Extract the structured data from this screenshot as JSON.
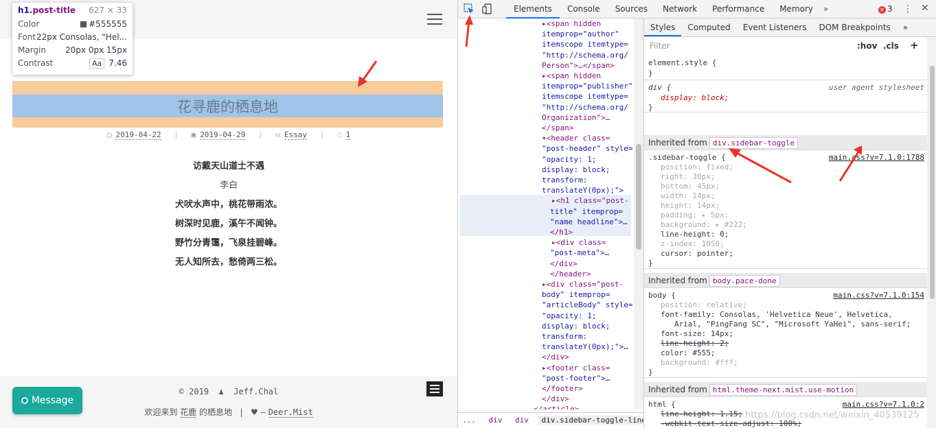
{
  "page": {
    "title": "花寻鹿的栖息地",
    "meta": [
      {
        "icon": "calendar-icon",
        "value": "2019-04-22"
      },
      {
        "icon": "calendar-check-icon",
        "value": "2019-04-29"
      },
      {
        "icon": "folder-icon",
        "value": "Essay"
      },
      {
        "icon": "comment-icon",
        "value": "1"
      }
    ],
    "poem": {
      "title": "访戴天山道士不遇",
      "author": "李白",
      "lines": [
        "犬吠水声中，桃花带雨浓。",
        "树深时见鹿，溪午不闻钟。",
        "野竹分青霭，飞泉挂碧峰。",
        "无人知所去，愁倚两三松。"
      ]
    },
    "footer": {
      "copyright": "© 2019",
      "author": "Jeff.Chal",
      "welcome_prefix": "欢迎来到",
      "welcome_link": "花鹿",
      "welcome_suffix": "的栖息地",
      "separator": "|",
      "deer_link": "Deer.Mist",
      "dash": "–"
    },
    "message_button": "Message",
    "colors": {
      "title_bg": "#9fc4e7",
      "margin_bg": "#f9cc9d",
      "message_bg": "#1aa99a"
    }
  },
  "tooltip": {
    "selector_tag": "h1",
    "selector_class": ".post-title",
    "dims": "627 × 33",
    "rows": [
      {
        "label": "Color",
        "value": "#555555"
      },
      {
        "label": "Font",
        "value": "22px Consolas, \"Hel..."
      },
      {
        "label": "Margin",
        "value": "20px 0px 15px"
      },
      {
        "label": "Contrast",
        "badge": "Aa",
        "value": "7.46"
      }
    ]
  },
  "devtools": {
    "tabs": [
      "Elements",
      "Console",
      "Sources",
      "Network",
      "Performance",
      "Memory"
    ],
    "active_tab": "Elements",
    "error_count": "3",
    "style_tabs": [
      "Styles",
      "Computed",
      "Event Listeners",
      "DOM Breakpoints"
    ],
    "active_style_tab": "Styles",
    "filter_placeholder": "Filter",
    "hov": ":hov",
    "cls": ".cls",
    "plus": "+",
    "breadcrumbs": [
      "...",
      "div",
      "div",
      "div.sidebar-toggle-line-wrap"
    ],
    "dom_lines": [
      "▸<span hidden",
      "itemprop=\"author\"",
      "itemscope itemtype=",
      "\"http://schema.org/",
      "Person\">…</span>",
      "▸<span hidden",
      "itemprop=\"publisher\"",
      "itemscope itemtype=",
      "\"http://schema.org/",
      "Organization\">…",
      "</span>",
      "▾<header class=",
      "\"post-header\" style=",
      "\"opacity: 1;",
      "display: block;",
      "transform:",
      "translateY(0px);\">",
      "▸<h1 class=\"post-",
      "title\" itemprop=",
      "\"name headline\">…",
      "</h1>",
      "▸<div class=",
      "\"post-meta\">…",
      "</div>",
      "</header>",
      "▸<div class=\"post-",
      "body\" itemprop=",
      "\"articleBody\" style=",
      "\"opacity: 1;",
      "display: block;",
      "transform:",
      "translateY(0px);\">…",
      "</div>",
      "▸<footer class=",
      "\"post-footer\">…",
      "</footer>",
      "</div>",
      "</article>"
    ],
    "styles": {
      "element_style": "element.style {",
      "close": "}",
      "ua_selector": "div {",
      "ua_source": "user agent stylesheet",
      "ua_decl": "display: block;",
      "inherited_label": "Inherited from",
      "inh1": "div.sidebar-toggle",
      "rule1_selector": ".sidebar-toggle {",
      "rule1_source": "main.css?v=7.1.0:1788",
      "rule1": [
        "position: fixed;",
        "right: 30px;",
        "bottom: 45px;",
        "width: 14px;",
        "height: 14px;",
        "padding: ▸ 5px;",
        "background: ▸ #222;",
        "line-height: 0;",
        "z-index: 1050;",
        "cursor: pointer;"
      ],
      "inh2": "body.pace-done",
      "rule2_selector": "body {",
      "rule2_source": "main.css?v=7.1.0:154",
      "rule2": [
        "position: relative;",
        "font-family: Consolas, 'Helvetica Neue', Helvetica,",
        "   Arial, \"PingFang SC\", \"Microsoft YaHei\", sans-serif;",
        "font-size: 14px;",
        "line-height: 2;",
        "color: #555;",
        "background: #fff;"
      ],
      "inh3": "html.theme-next.mist.use-motion",
      "rule3_selector": "html {",
      "rule3_source": "main.css?v=7.1.0:2",
      "rule3": [
        "line-height: 1.15;",
        "-webkit-text-size-adjust: 100%;"
      ]
    }
  },
  "watermark": "https://blog.csdn.net/weixin_40539125"
}
